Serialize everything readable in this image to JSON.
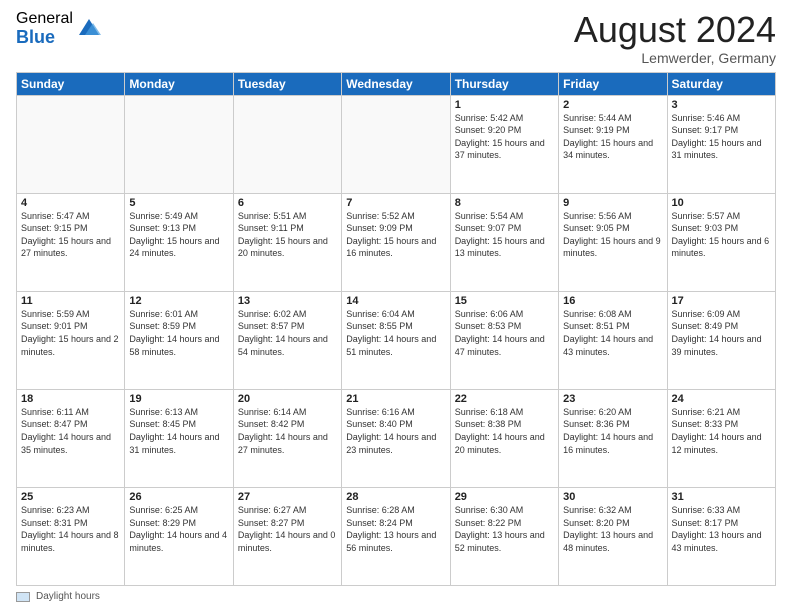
{
  "logo": {
    "general": "General",
    "blue": "Blue"
  },
  "title": "August 2024",
  "location": "Lemwerder, Germany",
  "footer": {
    "label": "Daylight hours"
  },
  "weekdays": [
    "Sunday",
    "Monday",
    "Tuesday",
    "Wednesday",
    "Thursday",
    "Friday",
    "Saturday"
  ],
  "weeks": [
    [
      {
        "day": "",
        "info": ""
      },
      {
        "day": "",
        "info": ""
      },
      {
        "day": "",
        "info": ""
      },
      {
        "day": "",
        "info": ""
      },
      {
        "day": "1",
        "info": "Sunrise: 5:42 AM\nSunset: 9:20 PM\nDaylight: 15 hours\nand 37 minutes."
      },
      {
        "day": "2",
        "info": "Sunrise: 5:44 AM\nSunset: 9:19 PM\nDaylight: 15 hours\nand 34 minutes."
      },
      {
        "day": "3",
        "info": "Sunrise: 5:46 AM\nSunset: 9:17 PM\nDaylight: 15 hours\nand 31 minutes."
      }
    ],
    [
      {
        "day": "4",
        "info": "Sunrise: 5:47 AM\nSunset: 9:15 PM\nDaylight: 15 hours\nand 27 minutes."
      },
      {
        "day": "5",
        "info": "Sunrise: 5:49 AM\nSunset: 9:13 PM\nDaylight: 15 hours\nand 24 minutes."
      },
      {
        "day": "6",
        "info": "Sunrise: 5:51 AM\nSunset: 9:11 PM\nDaylight: 15 hours\nand 20 minutes."
      },
      {
        "day": "7",
        "info": "Sunrise: 5:52 AM\nSunset: 9:09 PM\nDaylight: 15 hours\nand 16 minutes."
      },
      {
        "day": "8",
        "info": "Sunrise: 5:54 AM\nSunset: 9:07 PM\nDaylight: 15 hours\nand 13 minutes."
      },
      {
        "day": "9",
        "info": "Sunrise: 5:56 AM\nSunset: 9:05 PM\nDaylight: 15 hours\nand 9 minutes."
      },
      {
        "day": "10",
        "info": "Sunrise: 5:57 AM\nSunset: 9:03 PM\nDaylight: 15 hours\nand 6 minutes."
      }
    ],
    [
      {
        "day": "11",
        "info": "Sunrise: 5:59 AM\nSunset: 9:01 PM\nDaylight: 15 hours\nand 2 minutes."
      },
      {
        "day": "12",
        "info": "Sunrise: 6:01 AM\nSunset: 8:59 PM\nDaylight: 14 hours\nand 58 minutes."
      },
      {
        "day": "13",
        "info": "Sunrise: 6:02 AM\nSunset: 8:57 PM\nDaylight: 14 hours\nand 54 minutes."
      },
      {
        "day": "14",
        "info": "Sunrise: 6:04 AM\nSunset: 8:55 PM\nDaylight: 14 hours\nand 51 minutes."
      },
      {
        "day": "15",
        "info": "Sunrise: 6:06 AM\nSunset: 8:53 PM\nDaylight: 14 hours\nand 47 minutes."
      },
      {
        "day": "16",
        "info": "Sunrise: 6:08 AM\nSunset: 8:51 PM\nDaylight: 14 hours\nand 43 minutes."
      },
      {
        "day": "17",
        "info": "Sunrise: 6:09 AM\nSunset: 8:49 PM\nDaylight: 14 hours\nand 39 minutes."
      }
    ],
    [
      {
        "day": "18",
        "info": "Sunrise: 6:11 AM\nSunset: 8:47 PM\nDaylight: 14 hours\nand 35 minutes."
      },
      {
        "day": "19",
        "info": "Sunrise: 6:13 AM\nSunset: 8:45 PM\nDaylight: 14 hours\nand 31 minutes."
      },
      {
        "day": "20",
        "info": "Sunrise: 6:14 AM\nSunset: 8:42 PM\nDaylight: 14 hours\nand 27 minutes."
      },
      {
        "day": "21",
        "info": "Sunrise: 6:16 AM\nSunset: 8:40 PM\nDaylight: 14 hours\nand 23 minutes."
      },
      {
        "day": "22",
        "info": "Sunrise: 6:18 AM\nSunset: 8:38 PM\nDaylight: 14 hours\nand 20 minutes."
      },
      {
        "day": "23",
        "info": "Sunrise: 6:20 AM\nSunset: 8:36 PM\nDaylight: 14 hours\nand 16 minutes."
      },
      {
        "day": "24",
        "info": "Sunrise: 6:21 AM\nSunset: 8:33 PM\nDaylight: 14 hours\nand 12 minutes."
      }
    ],
    [
      {
        "day": "25",
        "info": "Sunrise: 6:23 AM\nSunset: 8:31 PM\nDaylight: 14 hours\nand 8 minutes."
      },
      {
        "day": "26",
        "info": "Sunrise: 6:25 AM\nSunset: 8:29 PM\nDaylight: 14 hours\nand 4 minutes."
      },
      {
        "day": "27",
        "info": "Sunrise: 6:27 AM\nSunset: 8:27 PM\nDaylight: 14 hours\nand 0 minutes."
      },
      {
        "day": "28",
        "info": "Sunrise: 6:28 AM\nSunset: 8:24 PM\nDaylight: 13 hours\nand 56 minutes."
      },
      {
        "day": "29",
        "info": "Sunrise: 6:30 AM\nSunset: 8:22 PM\nDaylight: 13 hours\nand 52 minutes."
      },
      {
        "day": "30",
        "info": "Sunrise: 6:32 AM\nSunset: 8:20 PM\nDaylight: 13 hours\nand 48 minutes."
      },
      {
        "day": "31",
        "info": "Sunrise: 6:33 AM\nSunset: 8:17 PM\nDaylight: 13 hours\nand 43 minutes."
      }
    ]
  ]
}
